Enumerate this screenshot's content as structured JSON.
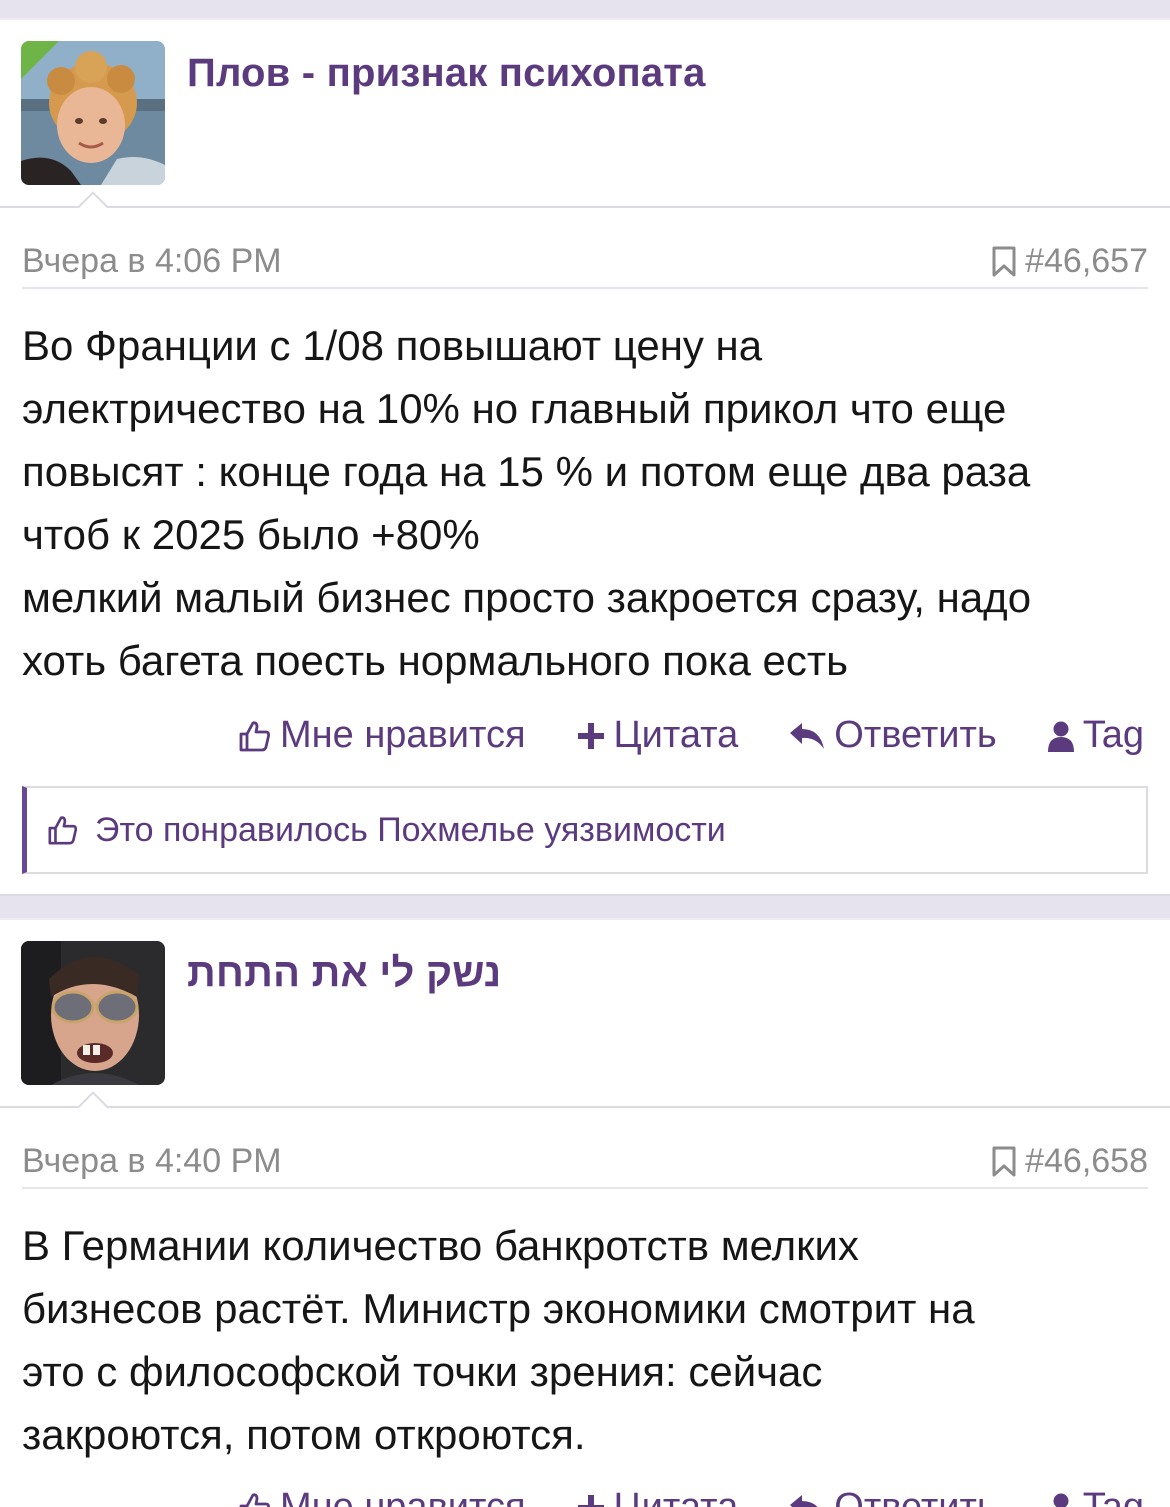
{
  "posts": [
    {
      "username": "Плов - признак психопата",
      "timestamp": "Вчера в 4:06 PM",
      "post_number": "#46,657",
      "message_lines": [
        "Во Франции с 1/08 повышают цену на",
        "электричество на 10% но главный прикол что еще",
        "повысят : конце года на 15 % и потом еще два раза",
        "чтоб к 2025 было +80%",
        "мелкий малый бизнес просто закроется сразу, надо",
        "хоть багета поесть нормального пока есть"
      ],
      "actions": {
        "like": "Мне нравится",
        "quote": "Цитата",
        "reply": "Ответить",
        "tag": "Tag"
      },
      "likes_text": "Это понравилось Похмелье уязвимости",
      "online": true
    },
    {
      "username": "נשק לי את התחת",
      "timestamp": "Вчера в 4:40 PM",
      "post_number": "#46,658",
      "message_lines": [
        "В Германии количество банкротств мелких",
        "бизнесов растёт. Министр экономики смотрит на",
        "это с философской точки зрения: сейчас",
        "закроются, потом откроются."
      ],
      "actions": {
        "like": "Мне нравится",
        "quote": "Цитата",
        "reply": "Ответить",
        "tag": "Tag"
      }
    }
  ],
  "colors": {
    "accent": "#5b3a7e",
    "online": "#6fb446",
    "background": "#e7e3ee"
  }
}
